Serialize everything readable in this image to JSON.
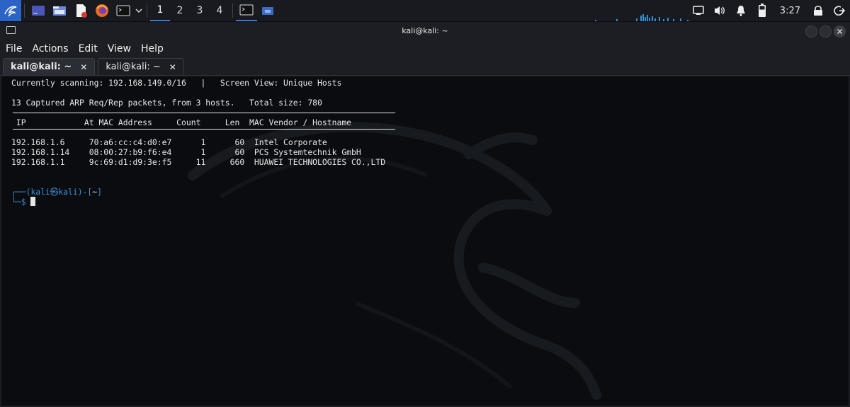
{
  "panel": {
    "workspaces": [
      "1",
      "2",
      "3",
      "4"
    ],
    "active_workspace": "1",
    "clock": "3:27",
    "icons": [
      "kali-menu-icon",
      "show-desktop-icon",
      "file-manager-icon",
      "text-editor-icon",
      "firefox-icon",
      "terminal-icon",
      "dropdown-chevron-icon",
      "terminal-task-icon",
      "file-manager-task-icon",
      "display-icon",
      "volume-icon",
      "notifications-icon",
      "battery-icon",
      "lock-icon",
      "logout-icon"
    ]
  },
  "window": {
    "title": "kali@kali: ~",
    "menu": [
      "File",
      "Actions",
      "Edit",
      "View",
      "Help"
    ],
    "tabs": [
      {
        "label": "kali@kali: ~",
        "close": "✕"
      },
      {
        "label": "kali@kali: ~",
        "close": "✕"
      }
    ]
  },
  "terminal": {
    "line_scan": "Currently scanning: 192.168.149.0/16   |   Screen View: Unique Hosts",
    "line_summary": "13 Captured ARP Req/Rep packets, from 3 hosts.   Total size: 780",
    "header": " IP            At MAC Address     Count     Len  MAC Vendor / Hostname",
    "rows": [
      "192.168.1.6     70:a6:cc:c4:d0:e7      1      60  Intel Corporate",
      "192.168.1.14    08:00:27:b9:f6:e4      1      60  PCS Systemtechnik GmbH",
      "192.168.1.1     9c:69:d1:d9:3e:f5     11     660  HUAWEI TECHNOLOGIES CO.,LTD"
    ],
    "prompt_line1_a": "┌──(",
    "prompt_user": "kali㉿kali",
    "prompt_line1_b": ")-[",
    "prompt_dir": "~",
    "prompt_line1_c": "]",
    "prompt_line2": "└─$ "
  }
}
